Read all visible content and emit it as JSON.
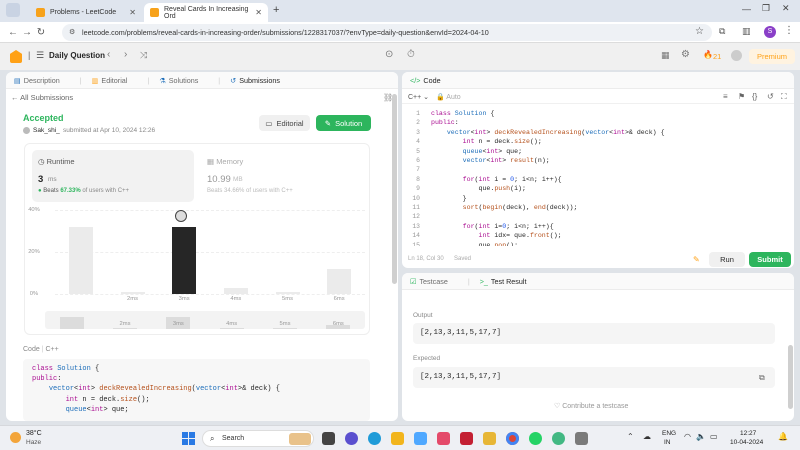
{
  "browser": {
    "tabs": [
      {
        "title": "Problems - LeetCode",
        "active": false
      },
      {
        "title": "Reveal Cards In Increasing Ord",
        "active": true
      }
    ],
    "url": "leetcode.com/problems/reveal-cards-in-increasing-order/submissions/1228317037/?envType=daily-question&envId=2024-04-10",
    "profile_initial": "S"
  },
  "header": {
    "title": "Daily Question",
    "streak": "21",
    "premium_label": "Premium"
  },
  "left_panel": {
    "tabs": [
      "Description",
      "Editorial",
      "Solutions",
      "Submissions"
    ],
    "back_label": "All Submissions",
    "status": "Accepted",
    "user": "Sak_shi_",
    "submitted_at": "submitted at Apr 10, 2024 12:26",
    "editorial_btn": "Editorial",
    "solution_btn": "Solution",
    "runtime": {
      "label": "Runtime",
      "value": "3",
      "unit": "ms",
      "beats_prefix": "Beats",
      "beats_pct": "67.33%",
      "beats_suffix": "of users with C++"
    },
    "memory": {
      "label": "Memory",
      "value": "10.99",
      "unit": "MB",
      "beats_text": "Beats 34.66% of users with C++"
    },
    "code_header": {
      "label": "Code",
      "lang": "C++"
    },
    "code_lines": [
      "class Solution {",
      "public:",
      "    vector<int> deckRevealedIncreasing(vector<int>& deck) {",
      "        int n = deck.size();",
      "        queue<int> que;"
    ]
  },
  "chart_data": {
    "type": "bar",
    "categories": [
      "",
      "2ms",
      "3ms",
      "4ms",
      "5ms",
      "6ms"
    ],
    "values": [
      32,
      1,
      32,
      3,
      1,
      12
    ],
    "ylim": [
      0,
      40
    ],
    "yticks": [
      "40%",
      "20%",
      "0%"
    ],
    "highlight_index": 2,
    "highlight_color": "#262626"
  },
  "right_panel": {
    "title": "Code",
    "lang": "C++",
    "mode": "Auto",
    "status_line": "Ln 18, Col 30",
    "saved": "Saved",
    "run_label": "Run",
    "submit_label": "Submit",
    "code": [
      "class Solution {",
      "public:",
      "    vector<int> deckRevealedIncreasing(vector<int>& deck) {",
      "        int n = deck.size();",
      "        queue<int> que;",
      "        vector<int> result(n);",
      "",
      "        for(int i = 0; i<n; i++){",
      "            que.push(i);",
      "        }",
      "        sort(begin(deck), end(deck));",
      "",
      "        for(int i=0; i<n; i++){",
      "            int idx= que.front();",
      "            que.pop();"
    ],
    "line_numbers": [
      "1",
      "2",
      "3",
      "4",
      "5",
      "6",
      "7",
      "8",
      "9",
      "10",
      "11",
      "12",
      "13",
      "14",
      "15"
    ]
  },
  "console": {
    "tabs": [
      "Testcase",
      "Test Result"
    ],
    "output_label": "Output",
    "output_value": "[2,13,3,11,5,17,7]",
    "expected_label": "Expected",
    "expected_value": "[2,13,3,11,5,17,7]",
    "contribute": "Contribute a testcase"
  },
  "taskbar": {
    "temp": "38°C",
    "weather": "Haze",
    "search": "Search",
    "lang1": "ENG",
    "lang2": "IN",
    "time": "12:27",
    "date": "10-04-2024"
  },
  "colors": {
    "accent_green": "#2db55d",
    "accepted_green": "#2db55d",
    "orange": "#ffa116"
  }
}
